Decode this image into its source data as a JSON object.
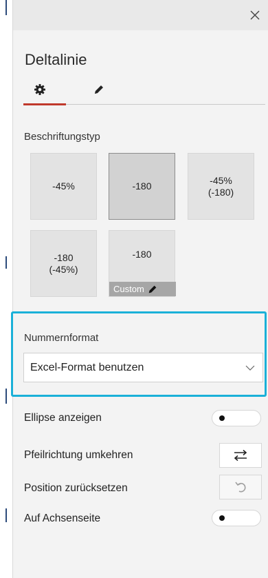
{
  "panel": {
    "title": "Deltalinie"
  },
  "tabs": [
    {
      "name": "settings",
      "icon": "gear-icon"
    },
    {
      "name": "style",
      "icon": "pencil-icon"
    }
  ],
  "label_type": {
    "heading": "Beschriftungstyp",
    "options": [
      {
        "line1": "-45%",
        "line2": ""
      },
      {
        "line1": "-180",
        "line2": ""
      },
      {
        "line1": "-45%",
        "line2": "(-180)"
      },
      {
        "line1": "-180",
        "line2": "(-45%)"
      },
      {
        "line1": "-180",
        "line2": ""
      }
    ],
    "custom_label": "Custom",
    "selected_index": 1
  },
  "number_format": {
    "heading": "Nummernformat",
    "value": "Excel-Format benutzen"
  },
  "settings": {
    "show_ellipse": "Ellipse anzeigen",
    "reverse_arrow": "Pfeilrichtung umkehren",
    "reset_position": "Position zurücksetzen",
    "on_axis_side": "Auf Achsenseite"
  },
  "colors": {
    "accent": "#c0392b",
    "focus": "#1ab0d8"
  }
}
